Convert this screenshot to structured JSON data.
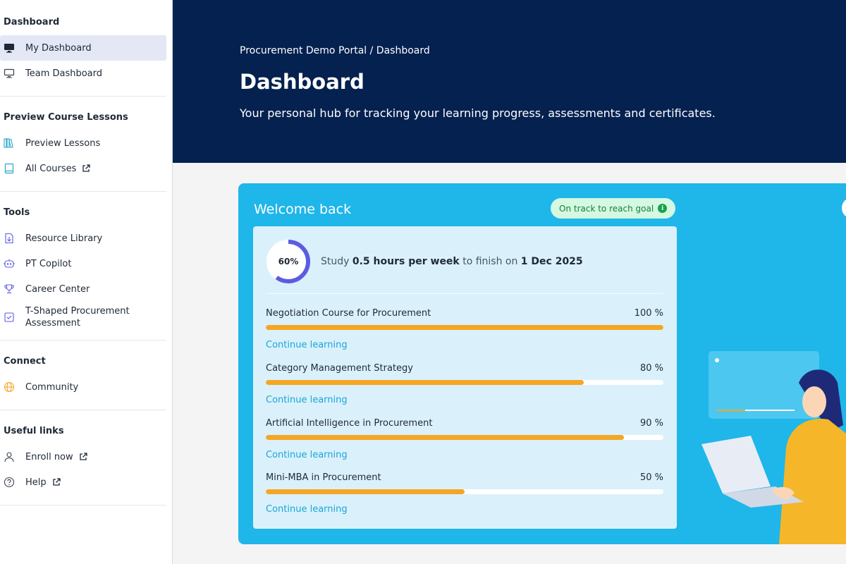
{
  "sidebar": {
    "sections": [
      {
        "title": "Dashboard",
        "items": [
          {
            "label": "My Dashboard",
            "icon": "monitor-icon"
          },
          {
            "label": "Team Dashboard",
            "icon": "monitor-icon"
          }
        ]
      },
      {
        "title": "Preview Course Lessons",
        "items": [
          {
            "label": "Preview Lessons",
            "icon": "books-icon"
          },
          {
            "label": "All Courses",
            "icon": "book-icon"
          }
        ]
      },
      {
        "title": "Tools",
        "items": [
          {
            "label": "Resource Library",
            "icon": "download-file-icon"
          },
          {
            "label": "PT Copilot",
            "icon": "robot-icon"
          },
          {
            "label": "Career Center",
            "icon": "trophy-icon"
          },
          {
            "label": "T-Shaped Procurement Assessment",
            "icon": "checkbox-icon"
          }
        ]
      },
      {
        "title": "Connect",
        "items": [
          {
            "label": "Community",
            "icon": "globe-icon"
          }
        ]
      },
      {
        "title": "Useful links",
        "items": [
          {
            "label": "Enroll now",
            "icon": "user-icon"
          },
          {
            "label": "Help",
            "icon": "help-icon"
          }
        ]
      }
    ]
  },
  "header": {
    "breadcrumb": "Procurement Demo Portal / Dashboard",
    "title": "Dashboard",
    "subtitle": "Your personal hub for tracking your learning progress, assessments and certificates."
  },
  "welcome": {
    "title": "Welcome back",
    "badge": "On track to reach goal",
    "goal": {
      "percent_label": "60%",
      "percent": 60,
      "text_prefix": "Study ",
      "hours": "0.5 hours per week",
      "text_middle": " to finish on ",
      "date": "1 Dec 2025"
    },
    "courses": [
      {
        "name": "Negotiation Course for Procurement",
        "percent_label": "100 %",
        "progress": 1.0,
        "link": "Continue learning"
      },
      {
        "name": "Category Management Strategy",
        "percent_label": "80 %",
        "progress": 0.8,
        "link": "Continue learning"
      },
      {
        "name": "Artificial Intelligence in Procurement",
        "percent_label": "90 %",
        "progress": 0.9,
        "link": "Continue learning"
      },
      {
        "name": "Mini-MBA in Procurement",
        "percent_label": "50 %",
        "progress": 0.5,
        "link": "Continue learning"
      }
    ]
  },
  "colors": {
    "header_bg": "#04214f",
    "card_bg": "#1fb6ea",
    "progress_fill": "#f5a623",
    "donut": "#5b5ce2",
    "link": "#1aa5d8"
  }
}
